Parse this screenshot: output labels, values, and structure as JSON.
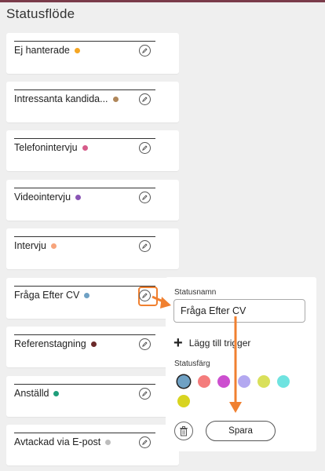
{
  "page": {
    "title": "Statusflöde"
  },
  "statuses": [
    {
      "label": "Ej hanterade",
      "color": "#f5a623"
    },
    {
      "label": "Intressanta kandida...",
      "color": "#b0875a"
    },
    {
      "label": "Telefonintervju",
      "color": "#d65c8a"
    },
    {
      "label": "Videointervju",
      "color": "#8a55b5"
    },
    {
      "label": "Intervju",
      "color": "#f7a47c"
    },
    {
      "label": "Fråga Efter CV",
      "color": "#6fa1c4"
    },
    {
      "label": "Referenstagning",
      "color": "#6b2a2a"
    },
    {
      "label": "Anställd",
      "color": "#1f9e7a"
    },
    {
      "label": "Avtackad via E-post",
      "color": "#bdbdbd"
    }
  ],
  "panel": {
    "name_label": "Statusnamn",
    "name_value": "Fråga Efter CV",
    "add_trigger_label": "Lägg till trigger",
    "color_label": "Statusfärg",
    "colors": [
      "#6fa1c4",
      "#f47c7c",
      "#cc4fcf",
      "#b3a8f0",
      "#d9e05a",
      "#6fe3e0",
      "#d8d420"
    ],
    "selected_color": "#6fa1c4",
    "save_label": "Spara"
  },
  "icons": {
    "edit": "pencil-circle-icon",
    "delete": "trash-icon",
    "add": "plus-icon"
  },
  "accent": "#f08030"
}
